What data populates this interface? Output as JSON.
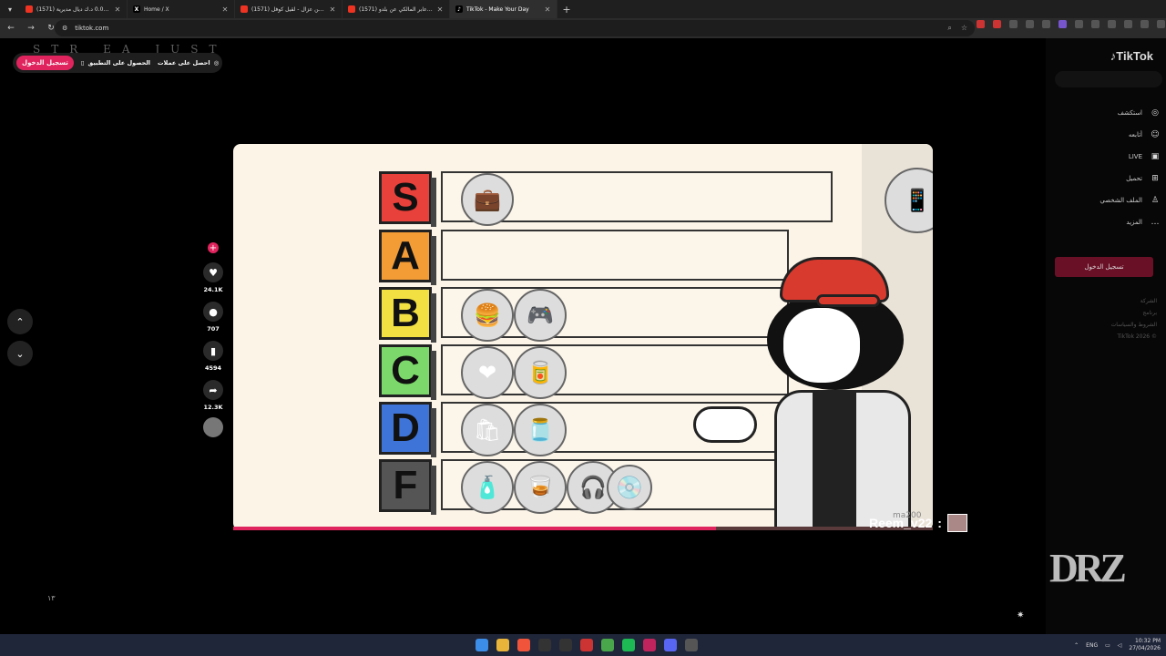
{
  "tabs": [
    {
      "title": "(1571) دريف مايك بعد 0.000 د.ك ديال مديرية",
      "icon": "youtube-icon"
    },
    {
      "title": "Home / X",
      "icon": "x-icon"
    },
    {
      "title": "(1571) حسين عزال - لقيل كوفل / ...",
      "icon": "youtube-icon"
    },
    {
      "title": "(1571) كلام عابر المالكي عن بلدو...",
      "icon": "youtube-icon"
    },
    {
      "title": "TikTok - Make Your Day",
      "icon": "tiktok-icon"
    }
  ],
  "address": {
    "url": "tiktok.com"
  },
  "topbar": {
    "login_label": "تسجيل الدخول",
    "get_app_label": "الحصول على التطبيق",
    "get_coins_label": "احصل على عملات"
  },
  "watermark_text": "STR EA JUST",
  "video_actions": {
    "likes": "24.1K",
    "comments": "707",
    "saves": "4594",
    "shares": "12.3K"
  },
  "tier_labels": [
    "S",
    "A",
    "B",
    "C",
    "D",
    "F"
  ],
  "tier_colors": [
    "#e8403a",
    "#f39c35",
    "#f2e043",
    "#7cd86a",
    "#3e74d8",
    "#555555"
  ],
  "comment_overlay": {
    "username": "Reem_v22",
    "separator": ":",
    "watermark_id": "ma200"
  },
  "video_progress": 0.69,
  "sidebar": {
    "logo": "TikTok",
    "items": [
      {
        "label": "استكشف",
        "icon": "compass-icon"
      },
      {
        "label": "أتابعه",
        "icon": "person-icon"
      },
      {
        "label": "LIVE",
        "icon": "live-icon"
      },
      {
        "label": "تحميل",
        "icon": "upload-icon"
      },
      {
        "label": "الملف الشخصي",
        "icon": "profile-icon"
      },
      {
        "label": "المزيد",
        "icon": "more-icon"
      }
    ],
    "login_button": "تسجيل الدخول",
    "footer": [
      "الشركة",
      "برنامج",
      "الشروط والسياسات",
      "TikTok 2026 ©"
    ]
  },
  "stream_logo": "DRZ",
  "corner_text": "١٣",
  "taskbar": {
    "lang": "ENG",
    "time": "10:32 PM",
    "date": "27/04/2026"
  }
}
